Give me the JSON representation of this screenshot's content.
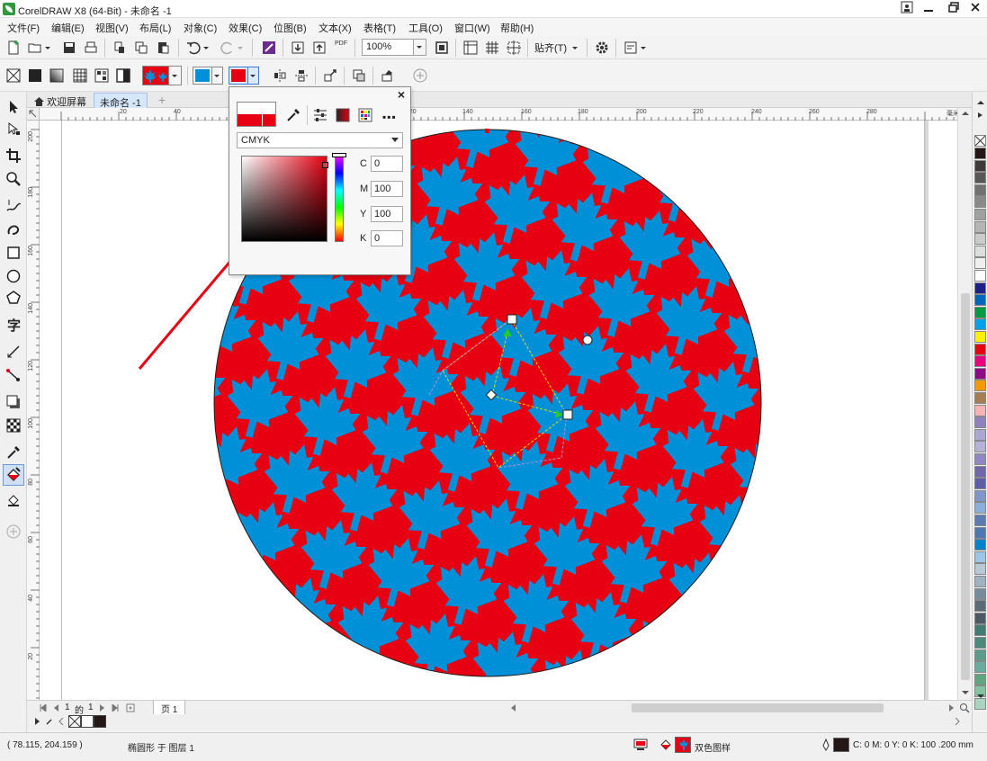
{
  "window": {
    "title": "CorelDRAW X8 (64-Bit) - 未命名 -1",
    "controls": [
      "minimize",
      "restore",
      "close"
    ]
  },
  "menu": {
    "items": [
      "文件(F)",
      "编辑(E)",
      "视图(V)",
      "布局(L)",
      "对象(C)",
      "效果(C)",
      "位图(B)",
      "文本(X)",
      "表格(T)",
      "工具(O)",
      "窗口(W)",
      "帮助(H)"
    ]
  },
  "toolbar1": {
    "zoom_value": "100%",
    "snap_label": "贴齐(T)",
    "pdf_label": "PDF"
  },
  "doc_tabs": {
    "welcome": "欢迎屏幕",
    "document": "未命名 -1"
  },
  "ruler_top": [
    "20",
    "40",
    "60",
    "80",
    "100",
    "120",
    "140",
    "160",
    "180",
    "200",
    "220",
    "240",
    "260",
    "280"
  ],
  "ruler_left": [
    "200",
    "180",
    "160",
    "140",
    "120",
    "100",
    "80",
    "60",
    "40",
    "20"
  ],
  "ruler_unit": "毫米",
  "color_popup": {
    "model": "CMYK",
    "c_label": "C",
    "c_value": "0",
    "m_label": "M",
    "m_value": "100",
    "y_label": "Y",
    "y_value": "100",
    "k_label": "K",
    "k_value": "0"
  },
  "page_nav": {
    "current": "1",
    "of_label": "的",
    "total": "1",
    "page_tab": "页 1"
  },
  "status": {
    "coords": "( 78.115, 204.159 )",
    "object_info": "椭圆形 于 图层 1",
    "fill_type": "双色图样",
    "outline_info": "C: 0 M: 0 Y: 0 K: 100  .200 mm"
  },
  "colors": {
    "fill_red": "#e60012",
    "fill_blue": "#0090d8",
    "accent_green": "#2f9a3c"
  },
  "palette": [
    "#231815",
    "#3e3a39",
    "#595757",
    "#727171",
    "#898989",
    "#9fa0a0",
    "#b5b5b6",
    "#c9caca",
    "#dcdddd",
    "#efefef",
    "#ffffff",
    "#1d2088",
    "#0068b7",
    "#009944",
    "#00a0e9",
    "#fff100",
    "#e60012",
    "#e4007f",
    "#920783",
    "#f39800",
    "#a67c52",
    "#f8b4b4",
    "#8f82bc",
    "#aba7d3",
    "#b3b3d8",
    "#8f87c2",
    "#6f67ad",
    "#5d5da8",
    "#7e97c8",
    "#8ab0d9",
    "#5a7cb3",
    "#4e79b0",
    "#0081cc",
    "#9cc7e6",
    "#b8c9d6",
    "#a0b2c2",
    "#758c9c",
    "#5b6b78",
    "#4b5a64",
    "#427b72",
    "#4d8a7b",
    "#5a9b8c",
    "#6aab9e",
    "#5fa57f",
    "#84c3a2",
    "#a9d5c0"
  ]
}
